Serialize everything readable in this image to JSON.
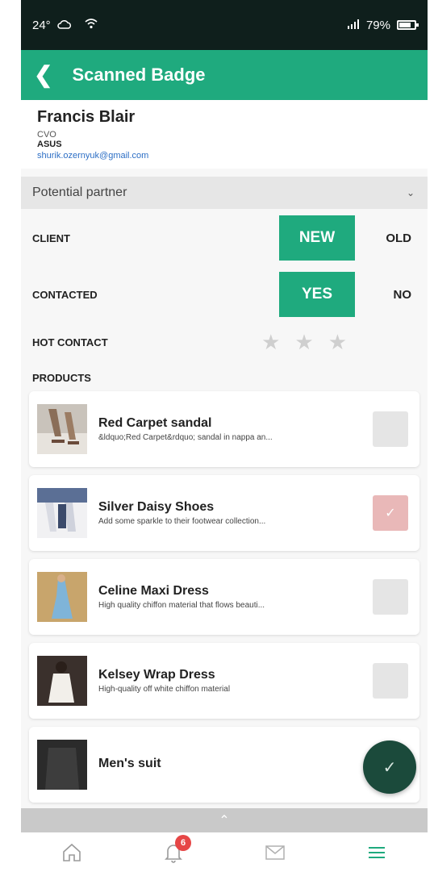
{
  "status_bar": {
    "temperature": "24°",
    "battery_percent": "79%",
    "battery_level": 0.79
  },
  "header": {
    "title": "Scanned Badge"
  },
  "contact": {
    "name": "Francis Blair",
    "role": "CVO",
    "company": "ASUS",
    "email": "shurik.ozernyuk@gmail.com"
  },
  "category": {
    "selected": "Potential partner"
  },
  "client": {
    "label": "CLIENT",
    "option_on": "NEW",
    "option_off": "OLD"
  },
  "contacted": {
    "label": "CONTACTED",
    "option_on": "YES",
    "option_off": "NO"
  },
  "hot_contact": {
    "label": "HOT CONTACT",
    "rating": 0,
    "max": 3
  },
  "products": {
    "label": "PRODUCTS",
    "items": [
      {
        "name": "Red Carpet sandal",
        "desc": "&ldquo;Red Carpet&rdquo; sandal in nappa an...",
        "checked": false
      },
      {
        "name": "Silver Daisy Shoes",
        "desc": "Add some sparkle to their footwear collection...",
        "checked": true
      },
      {
        "name": "Celine Maxi Dress",
        "desc": "High quality chiffon material that flows beauti...",
        "checked": false
      },
      {
        "name": "Kelsey Wrap Dress",
        "desc": "High-quality off white chiffon material",
        "checked": false
      },
      {
        "name": "Men's suit",
        "desc": "",
        "checked": false
      }
    ]
  },
  "nav": {
    "notifications_count": "6"
  },
  "colors": {
    "accent": "#1faa7e",
    "status_bar": "#0f1f1c",
    "fab": "#1b4a3b",
    "badge": "#e64646"
  }
}
